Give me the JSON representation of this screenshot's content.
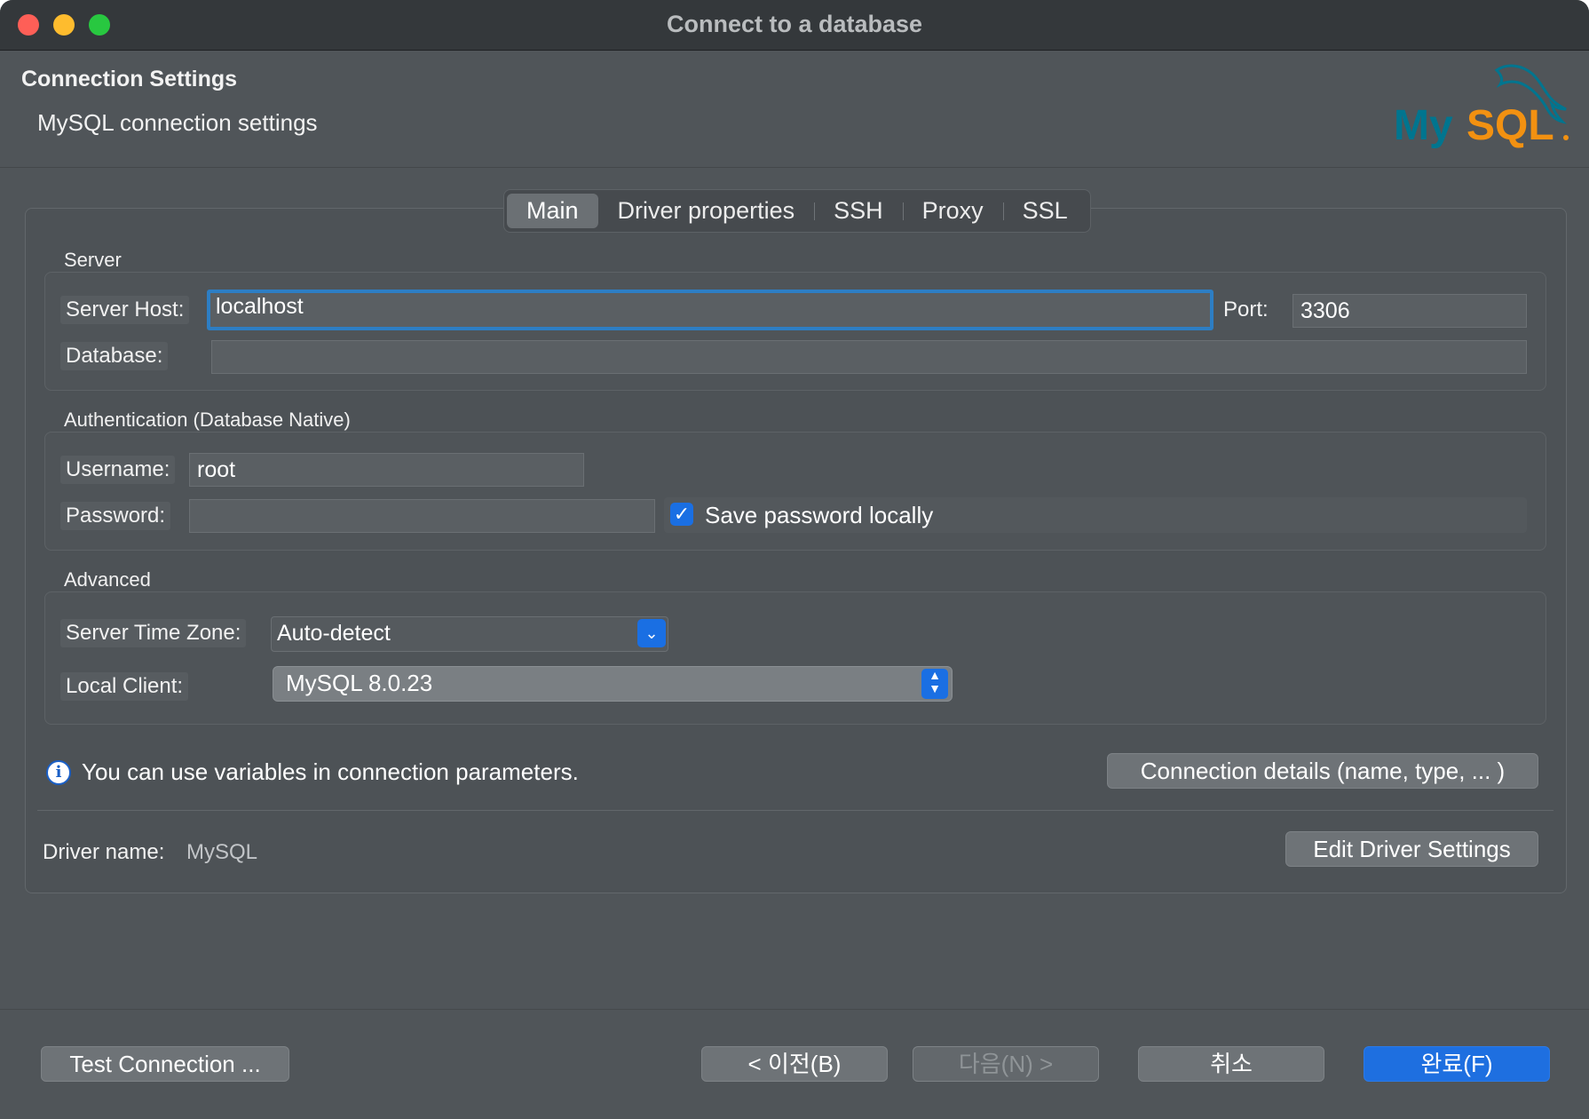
{
  "window": {
    "title": "Connect to a database"
  },
  "header": {
    "title": "Connection Settings",
    "subtitle": "MySQL connection settings",
    "logo_text": "MySQL"
  },
  "tabs": [
    {
      "label": "Main",
      "selected": true
    },
    {
      "label": "Driver properties"
    },
    {
      "label": "SSH"
    },
    {
      "label": "Proxy"
    },
    {
      "label": "SSL"
    }
  ],
  "server": {
    "group_label": "Server",
    "host_label": "Server Host:",
    "host_value": "localhost",
    "port_label": "Port:",
    "port_value": "3306",
    "database_label": "Database:",
    "database_value": ""
  },
  "auth": {
    "group_label": "Authentication (Database Native)",
    "username_label": "Username:",
    "username_value": "root",
    "password_label": "Password:",
    "password_value": "",
    "save_password_label": "Save password locally",
    "save_password_checked": true
  },
  "advanced": {
    "group_label": "Advanced",
    "timezone_label": "Server Time Zone:",
    "timezone_value": "Auto-detect",
    "local_client_label": "Local Client:",
    "local_client_value": "MySQL 8.0.23"
  },
  "info": {
    "text": "You can use variables in connection parameters.",
    "details_button": "Connection details (name, type, ... )"
  },
  "driver": {
    "label": "Driver name:",
    "value": "MySQL",
    "edit_button": "Edit Driver Settings"
  },
  "footer": {
    "test_button": "Test Connection ...",
    "back_button": "< 이전(B)",
    "next_button": "다음(N) >",
    "cancel_button": "취소",
    "finish_button": "완료(F)"
  },
  "colors": {
    "accent": "#1e6fe0",
    "focus_ring": "#2d7ec4",
    "mysql_blue": "#00758f",
    "mysql_orange": "#f29111"
  }
}
